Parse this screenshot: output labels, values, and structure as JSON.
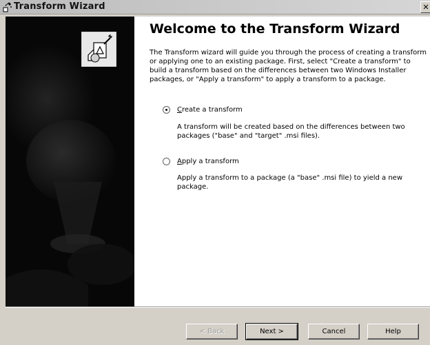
{
  "window": {
    "title": "Transform Wizard",
    "close_glyph": "✕"
  },
  "page": {
    "heading": "Welcome to the Transform Wizard",
    "intro": "The Transform wizard will guide you through the process of creating a transform or applying one to an existing package. First, select \"Create a transform\" to build a transform based on the differences between two Windows Installer packages, or \"Apply a transform\" to apply a transform to a package."
  },
  "options": [
    {
      "mnemonic": "C",
      "label_rest": "reate a transform",
      "description": "A transform will be created based on the differences between two packages (\"base\" and \"target\" .msi files).",
      "selected": true
    },
    {
      "mnemonic": "A",
      "label_rest": "pply a transform",
      "description": "Apply a transform to a package (a \"base\" .msi file) to yield a new package.",
      "selected": false
    }
  ],
  "buttons": {
    "back": "< Back",
    "next": "Next >",
    "cancel": "Cancel",
    "help": "Help"
  },
  "icons": {
    "title": "wizard-wand-icon",
    "wizard": "transform-package-icon",
    "close": "close-icon"
  },
  "colors": {
    "sidebar": "#070707",
    "content": "#ffffff",
    "chrome": "#d4d0c8"
  }
}
